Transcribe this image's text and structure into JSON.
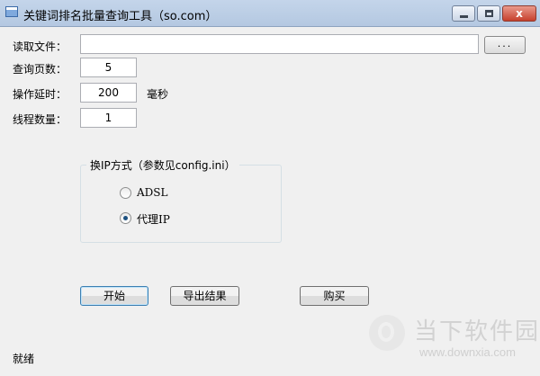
{
  "window": {
    "title": "关键词排名批量查询工具（so.com）",
    "close_glyph": "x"
  },
  "form": {
    "file_label": "读取文件：",
    "file_value": "",
    "browse_label": "...",
    "pages_label": "查询页数：",
    "pages_value": "5",
    "delay_label": "操作延时：",
    "delay_value": "200",
    "delay_unit": "毫秒",
    "threads_label": "线程数量：",
    "threads_value": "1"
  },
  "ip_group": {
    "legend": "换IP方式（参数见config.ini）",
    "options": [
      {
        "label": "ADSL",
        "checked": false
      },
      {
        "label": "代理IP",
        "checked": true
      }
    ]
  },
  "buttons": {
    "start": "开始",
    "export": "导出结果",
    "buy": "购买"
  },
  "status": {
    "text": "就绪"
  },
  "watermark": {
    "name": "当下软件园",
    "url": "www.downxia.com"
  },
  "colors": {
    "titlebar": "#b4c8e1",
    "window_bg": "#f0f0f0",
    "close_button": "#c6402c",
    "radio_dot": "#1c5180"
  },
  "icons": [
    "app-window-icon",
    "minimize-icon",
    "maximize-icon",
    "close-icon",
    "watermark-logo-icon"
  ]
}
